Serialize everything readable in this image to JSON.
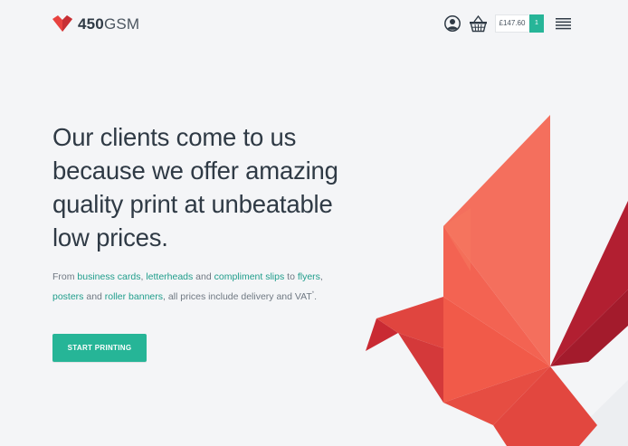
{
  "header": {
    "logo": {
      "number": "450",
      "unit": "GSM"
    },
    "cart": {
      "total": "£147.60",
      "count": "1"
    }
  },
  "hero": {
    "headline": "Our clients come to us because we offer amazing quality print at unbeatable low prices.",
    "subtext": {
      "prefix": "From ",
      "link_business_cards": "business cards",
      "sep1": ", ",
      "link_letterheads": "letterheads",
      "and1": " and ",
      "link_compliment_slips": "compliment slips",
      "to": " to ",
      "link_flyers": "flyers",
      "sep2": ",",
      "link_posters": "posters",
      "and2": " and ",
      "link_roller_banners": "roller banners",
      "suffix": ", all prices include delivery and VAT",
      "footnote_mark": "*",
      "end": "."
    },
    "cta_label": "START PRINTING"
  },
  "colors": {
    "accent": "#26b597",
    "link": "#1f9d8b",
    "logo_red": "#e8423f",
    "text_dark": "#2f3a45",
    "background": "#f4f5f7"
  },
  "icons": {
    "logo": "heart-chevron-icon",
    "account": "user-circle-icon",
    "basket": "basket-icon",
    "menu": "hamburger-menu-icon"
  }
}
